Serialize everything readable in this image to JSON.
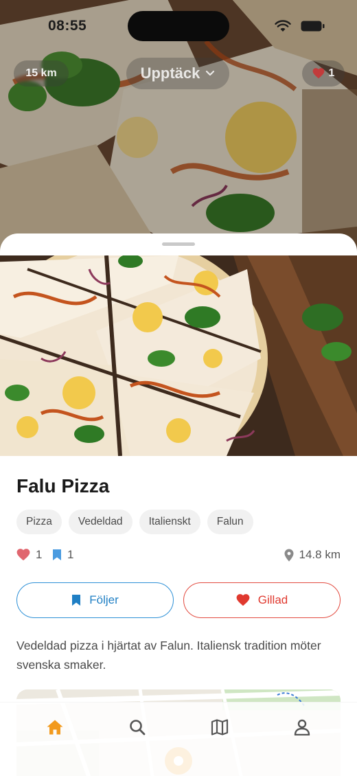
{
  "status_bar": {
    "time": "08:55"
  },
  "top_bar": {
    "distance": "15 km",
    "discover_label": "Upptäck",
    "likes_count": "1"
  },
  "venue": {
    "name": "Falu Pizza",
    "tags": [
      "Pizza",
      "Vedeldad",
      "Italienskt",
      "Falun"
    ],
    "like_count": "1",
    "bookmark_count": "1",
    "distance": "14.8 km",
    "follow_label": "Följer",
    "liked_label": "Gillad",
    "description": "Vedeldad pizza i hjärtat av Falun. Italiensk tradition möter svenska smaker."
  },
  "tabs": [
    {
      "icon": "home-icon",
      "active": true
    },
    {
      "icon": "search-icon",
      "active": false
    },
    {
      "icon": "map-icon",
      "active": false
    },
    {
      "icon": "profile-icon",
      "active": false
    }
  ],
  "colors": {
    "accent_orange": "#f29a1d",
    "follow_blue": "#1f7fc4",
    "like_red": "#e0392f",
    "heart_pink": "#e0666f",
    "bookmark_blue": "#4a9be0"
  }
}
